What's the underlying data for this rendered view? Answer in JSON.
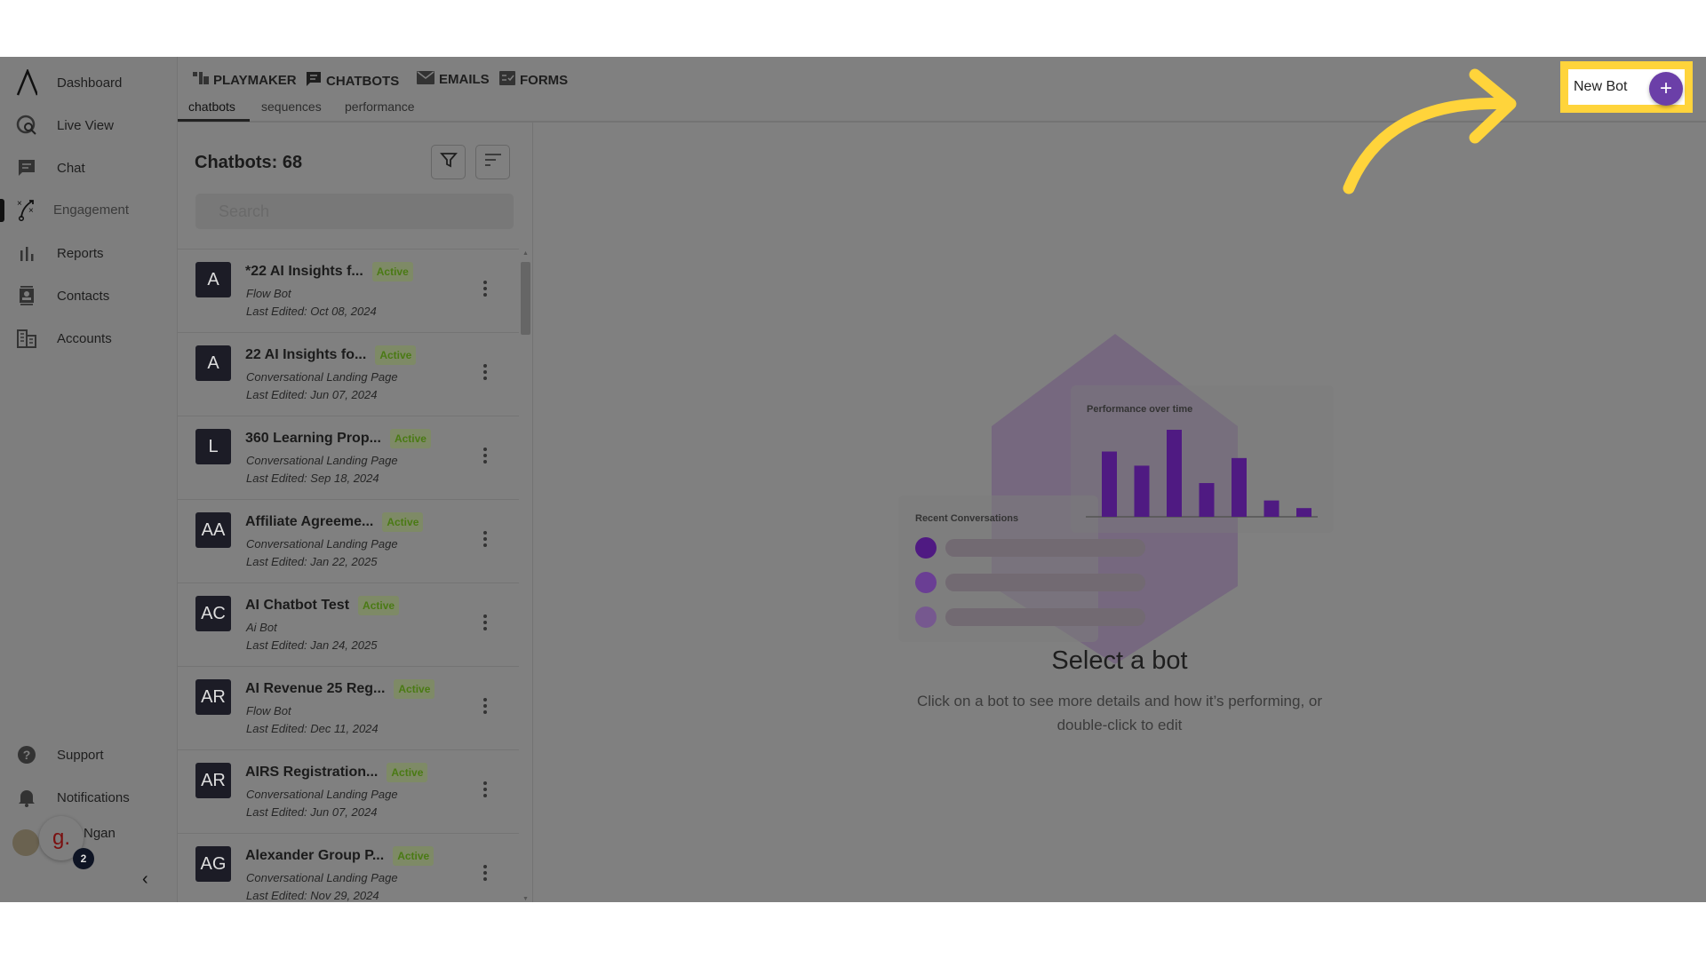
{
  "sidebar": {
    "items": [
      {
        "label": "Dashboard",
        "icon": "logo-icon"
      },
      {
        "label": "Live View",
        "icon": "live-view-icon"
      },
      {
        "label": "Chat",
        "icon": "chat-icon"
      },
      {
        "label": "Engagement",
        "icon": "engagement-icon",
        "active": true
      },
      {
        "label": "Reports",
        "icon": "bar-chart-icon"
      },
      {
        "label": "Contacts",
        "icon": "contacts-icon"
      },
      {
        "label": "Accounts",
        "icon": "building-icon"
      }
    ],
    "bottom": [
      {
        "label": "Support",
        "icon": "help-icon"
      },
      {
        "label": "Notifications",
        "icon": "bell-icon"
      }
    ],
    "user": {
      "name": "Ngan",
      "badge_count": "2",
      "logo_letter": "g."
    }
  },
  "header": {
    "tabs": [
      {
        "label": "PLAYMAKER",
        "icon": "playmaker-icon"
      },
      {
        "label": "CHATBOTS",
        "icon": "chatbot-icon"
      },
      {
        "label": "EMAILS",
        "icon": "email-icon"
      },
      {
        "label": "FORMS",
        "icon": "form-icon"
      }
    ],
    "subtabs": [
      {
        "label": "chatbots",
        "active": true
      },
      {
        "label": "sequences"
      },
      {
        "label": "performance"
      }
    ]
  },
  "panel": {
    "count_label": "Chatbots: 68",
    "search_placeholder": "Search",
    "status_color": "#4a7a14",
    "bots": [
      {
        "initials": "A",
        "name": "*22 AI Insights f...",
        "status": "Active",
        "type": "Flow Bot",
        "edited": "Last Edited: Oct 08, 2024"
      },
      {
        "initials": "A",
        "name": "22 AI Insights fo...",
        "status": "Active",
        "type": "Conversational Landing Page",
        "edited": "Last Edited: Jun 07, 2024"
      },
      {
        "initials": "L",
        "name": "360 Learning Prop...",
        "status": "Active",
        "type": "Conversational Landing Page",
        "edited": "Last Edited: Sep 18, 2024"
      },
      {
        "initials": "AA",
        "name": "Affiliate Agreeme...",
        "status": "Active",
        "type": "Conversational Landing Page",
        "edited": "Last Edited: Jan 22, 2025"
      },
      {
        "initials": "AC",
        "name": "AI Chatbot Test",
        "status": "Active",
        "type": "Ai Bot",
        "edited": "Last Edited: Jan 24, 2025"
      },
      {
        "initials": "AR",
        "name": "AI Revenue 25 Reg...",
        "status": "Active",
        "type": "Flow Bot",
        "edited": "Last Edited: Dec 11, 2024"
      },
      {
        "initials": "AR",
        "name": "AIRS Registration...",
        "status": "Active",
        "type": "Conversational Landing Page",
        "edited": "Last Edited: Jun 07, 2024"
      },
      {
        "initials": "AG",
        "name": "Alexander Group P...",
        "status": "Active",
        "type": "Conversational Landing Page",
        "edited": "Last Edited: Nov 29, 2024"
      }
    ]
  },
  "main": {
    "title": "Select a bot",
    "subtitle": "Click on a bot to see more details and how it’s performing, or double-click to edit",
    "illustration": {
      "performance_title": "Performance over time",
      "conversations_title": "Recent Conversations",
      "bars": [
        60,
        47,
        80,
        31,
        54,
        15,
        8
      ],
      "accent": "#4f1a82"
    }
  },
  "new_bot": {
    "label": "New Bot",
    "accent": "#6b3fa8",
    "highlight": "#ffd43b"
  }
}
